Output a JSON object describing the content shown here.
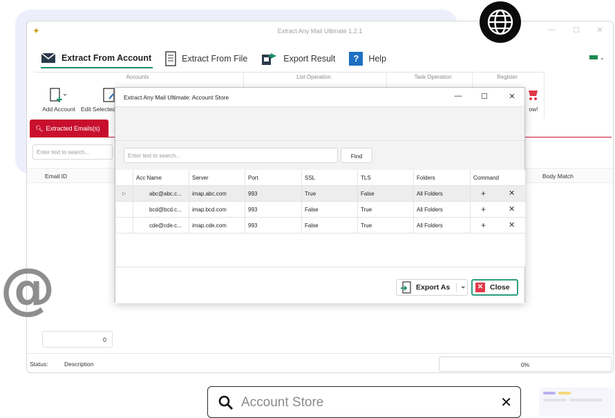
{
  "app": {
    "window_title": "Extract Any Mail Ultimate 1.2.1",
    "menu_tabs": [
      {
        "label": "Extract From Account",
        "icon": "envelope-icon",
        "active": true
      },
      {
        "label": "Extract From File",
        "icon": "document-icon",
        "active": false
      },
      {
        "label": "Export Result",
        "icon": "export-icon",
        "active": false
      },
      {
        "label": "Help",
        "icon": "help-icon",
        "active": false
      }
    ],
    "ribbon": {
      "groups": [
        "Accounts",
        "List Operation",
        "Task Operation",
        "Register"
      ],
      "buttons": [
        "Add Account",
        "Edit Selected"
      ],
      "register_partial": "ow!"
    },
    "result_tab": "Extracted Emails(s)",
    "search_placeholder": "Enter text to search...",
    "columns": [
      "Email ID",
      "Body Match"
    ],
    "count": "0",
    "status": {
      "label": "Status:",
      "description": "Description",
      "progress": "0%"
    }
  },
  "dialog": {
    "title": "Extract Any Mail Ultimate: Account Store",
    "search_placeholder": "Enter text to search...",
    "find_label": "Find",
    "headers": [
      "Acc Name",
      "Server",
      "Port",
      "SSL",
      "TLS",
      "Folders",
      "Command"
    ],
    "rows": [
      {
        "acc": "abc@abc.c...",
        "server": "imap.abc.com",
        "port": "993",
        "ssl": "True",
        "tls": "False",
        "folders": "All Folders"
      },
      {
        "acc": "bcd@bcd.c...",
        "server": "imap.bcd.com",
        "port": "993",
        "ssl": "False",
        "tls": "True",
        "folders": "All Folders"
      },
      {
        "acc": "cde@cde.c...",
        "server": "imap.cde.com",
        "port": "993",
        "ssl": "False",
        "tls": "True",
        "folders": "All Folders"
      }
    ],
    "export_label": "Export As",
    "close_label": "Close"
  },
  "searchbar": {
    "query": "Account Store"
  },
  "colors": {
    "accent_green": "#1a8e6b",
    "tab_red": "#c8102e",
    "close_red": "#e2374a"
  }
}
